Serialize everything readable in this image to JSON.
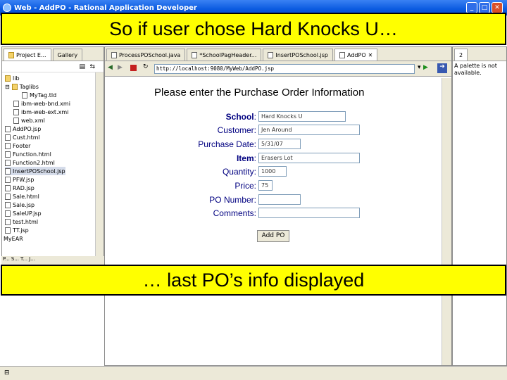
{
  "window": {
    "title": "Web - AddPO - Rational Application Developer"
  },
  "captions": {
    "top": "So if user chose Hard Knocks U…",
    "bottom": "… last PO’s info displayed"
  },
  "left_panel": {
    "tabs": [
      "Project E...",
      "Gallery"
    ],
    "tree": [
      "lib",
      "Taglibs",
      "MyTag.tld",
      "ibm-web-bnd.xmi",
      "ibm-web-ext.xmi",
      "web.xml",
      "AddPO.jsp",
      "Cust.html",
      "Footer",
      "Function.html",
      "Function2.html",
      "InsertPOSchool.jsp",
      "PFW.jsp",
      "RAD.jsp",
      "Sale.html",
      "Sale.jsp",
      "SaleUP.jsp",
      "test.html",
      "TT.jsp",
      "MyEAR"
    ],
    "bottom_tabs": [
      "P...",
      "S...",
      "T...",
      "J..."
    ]
  },
  "editor": {
    "tabs": [
      "ProcessPOSchool.java",
      "*SchoolPagHeader...",
      "InsertPOSchool.jsp",
      "AddPO"
    ],
    "url": "http://localhost:9080/MyWeb/AddPO.jsp",
    "form": {
      "heading": "Please enter the Purchase Order Information",
      "fields": [
        {
          "label": "School",
          "value": "Hard Knocks U"
        },
        {
          "label": "Customer",
          "value": "Jen Around"
        },
        {
          "label": "Purchase Date",
          "value": "5/31/07"
        },
        {
          "label": "Item",
          "value": "Erasers Lot"
        },
        {
          "label": "Quantity",
          "value": "1000"
        },
        {
          "label": "Price",
          "value": "75"
        },
        {
          "label": "PO Number",
          "value": ""
        },
        {
          "label": "Comments",
          "value": ""
        }
      ],
      "submit_label": "Add PO"
    }
  },
  "right_panel": {
    "tab": "2",
    "text": "A palette is not available."
  }
}
